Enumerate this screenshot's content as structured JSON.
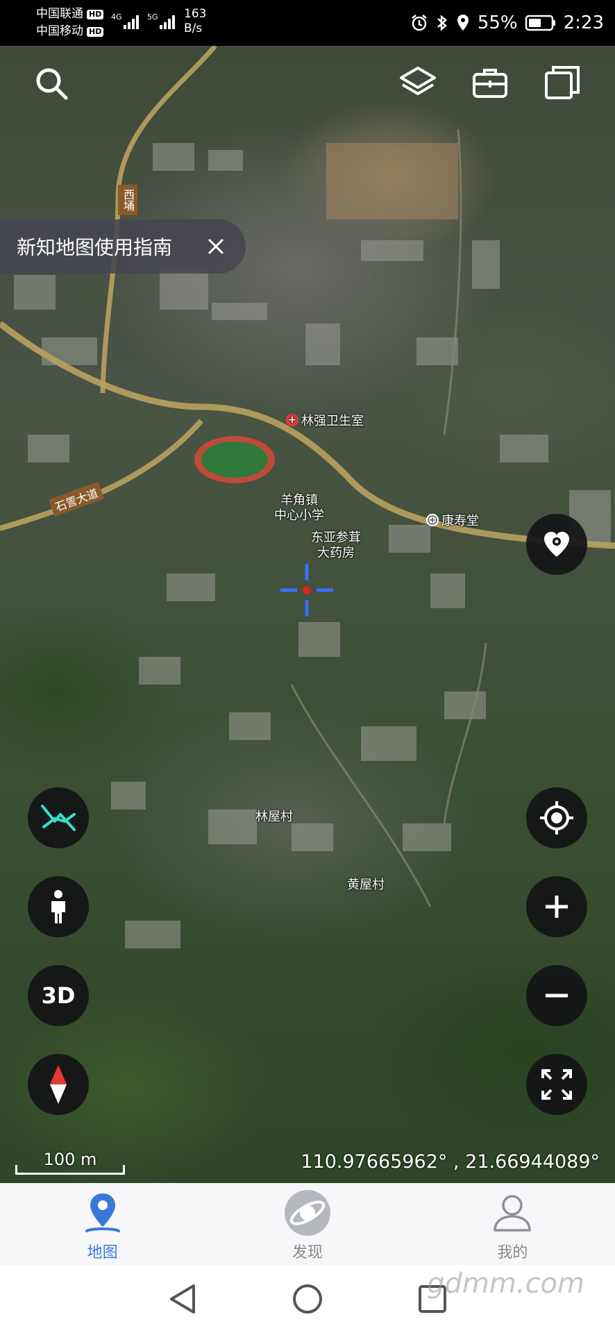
{
  "status_bar": {
    "carrier_1": "中国联通",
    "carrier_2": "中国移动",
    "hd_badge": "HD",
    "network_1": "4G",
    "network_2": "5G",
    "speed_value": "163",
    "speed_unit": "B/s",
    "battery_percent": "55%",
    "time": "2:23"
  },
  "toolbar": {
    "icons": [
      "search-icon",
      "layers-icon",
      "toolbox-icon",
      "copy-icon"
    ]
  },
  "guide_banner": {
    "text": "新知地图使用指南"
  },
  "map": {
    "roads": {
      "road_1": "石詈大道",
      "road_2": "西埇"
    },
    "pois": {
      "clinic": "林强卫生室",
      "school_line1": "羊角镇",
      "school_line2": "中心小学",
      "pharmacy_line1": "东亚参茸",
      "pharmacy_line2": "大药房",
      "kangshoutang": "康寿堂"
    },
    "villages": {
      "village_1": "林屋村",
      "village_2": "黄屋村"
    },
    "scale": "100 m",
    "coordinates": "110.97665962° , 21.66944089°"
  },
  "map_buttons": {
    "three_d": "3D"
  },
  "tabs": [
    {
      "label": "地图",
      "active": true,
      "icon": "map-pin-icon"
    },
    {
      "label": "发现",
      "active": false,
      "icon": "discover-icon"
    },
    {
      "label": "我的",
      "active": false,
      "icon": "profile-icon"
    }
  ],
  "colors": {
    "accent": "#3a78d8",
    "button_bg": "#141416",
    "route_cyan": "#35e0d0",
    "crosshair_blue": "#3b6fff",
    "crosshair_center": "#e02020"
  },
  "watermark": "gdmm.com"
}
